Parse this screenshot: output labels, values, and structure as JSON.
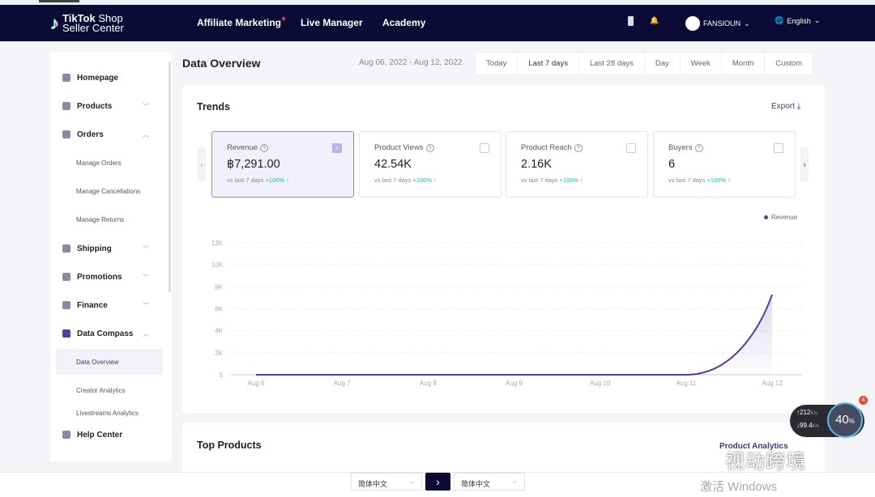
{
  "nav": {
    "brand_line1_bold": "TikTok",
    "brand_line1": " Shop",
    "brand_line2": "Seller Center",
    "links": [
      "Affiliate Marketing",
      "Live Manager",
      "Academy"
    ],
    "shop_name": "FANSIOUN",
    "language": "English"
  },
  "sidebar": {
    "items": [
      {
        "label": "Homepage",
        "icon": "home-icon"
      },
      {
        "label": "Products",
        "icon": "box-icon",
        "chevron": "down"
      },
      {
        "label": "Orders",
        "icon": "orders-icon",
        "chevron": "up"
      },
      {
        "label": "Manage Orders",
        "sub": true
      },
      {
        "label": "Manage Cancellations",
        "sub": true
      },
      {
        "label": "Manage Returns",
        "sub": true
      },
      {
        "label": "Shipping",
        "icon": "truck-icon",
        "chevron": "down"
      },
      {
        "label": "Promotions",
        "icon": "megaphone-icon",
        "chevron": "down"
      },
      {
        "label": "Finance",
        "icon": "card-icon",
        "chevron": "down"
      },
      {
        "label": "Data Compass",
        "icon": "bar-chart-icon",
        "chevron": "up"
      },
      {
        "label": "Data Overview",
        "sub": true,
        "active": true
      },
      {
        "label": "Creator Analytics",
        "sub": true
      },
      {
        "label": "Livestreams Analytics",
        "sub": true
      },
      {
        "label": "Help Center",
        "icon": "help-icon"
      }
    ]
  },
  "header": {
    "title": "Data Overview",
    "date_range": "Aug 06, 2022 - Aug 12, 2022",
    "periods": [
      "Today",
      "Last 7 days",
      "Last 28 days",
      "Day",
      "Week",
      "Month",
      "Custom"
    ],
    "active_period": "Last 7 days"
  },
  "trends": {
    "title": "Trends",
    "export": "Export",
    "kpis": [
      {
        "label": "Revenue",
        "value": "฿7,291.00",
        "compare": "vs last 7 days",
        "change": "+100%",
        "selected": true
      },
      {
        "label": "Product Views",
        "value": "42.54K",
        "compare": "vs last 7 days",
        "change": "+100%",
        "selected": false
      },
      {
        "label": "Product Reach",
        "value": "2.16K",
        "compare": "vs last 7 days",
        "change": "+100%",
        "selected": false
      },
      {
        "label": "Buyers",
        "value": "6",
        "compare": "vs last 7 days",
        "change": "+100%",
        "selected": false
      }
    ]
  },
  "chart_data": {
    "type": "area",
    "categories": [
      "Aug 6",
      "Aug 7",
      "Aug 8",
      "Aug 9",
      "Aug 10",
      "Aug 11",
      "Aug 12"
    ],
    "series": [
      {
        "name": "Revenue",
        "values": [
          0,
          0,
          0,
          0,
          0,
          0,
          7291
        ]
      }
    ],
    "yticks": [
      "0",
      "2K",
      "4K",
      "6K",
      "8K",
      "10K",
      "12K"
    ],
    "ylim": [
      0,
      12000
    ],
    "grid": true,
    "legend": "top-right",
    "color": "#4e3fa0"
  },
  "top_products": {
    "title": "Top Products",
    "link": "Product Analytics"
  },
  "bottom": {
    "source_lang": "简体中文",
    "target_lang": "简体中文",
    "watermark": "激活 Windows",
    "wechat": "视动跨境"
  },
  "speed": {
    "up": "212",
    "down": "99.4",
    "unit": "K/s",
    "percent": "40",
    "pct_sign": "%",
    "badge": "4"
  }
}
